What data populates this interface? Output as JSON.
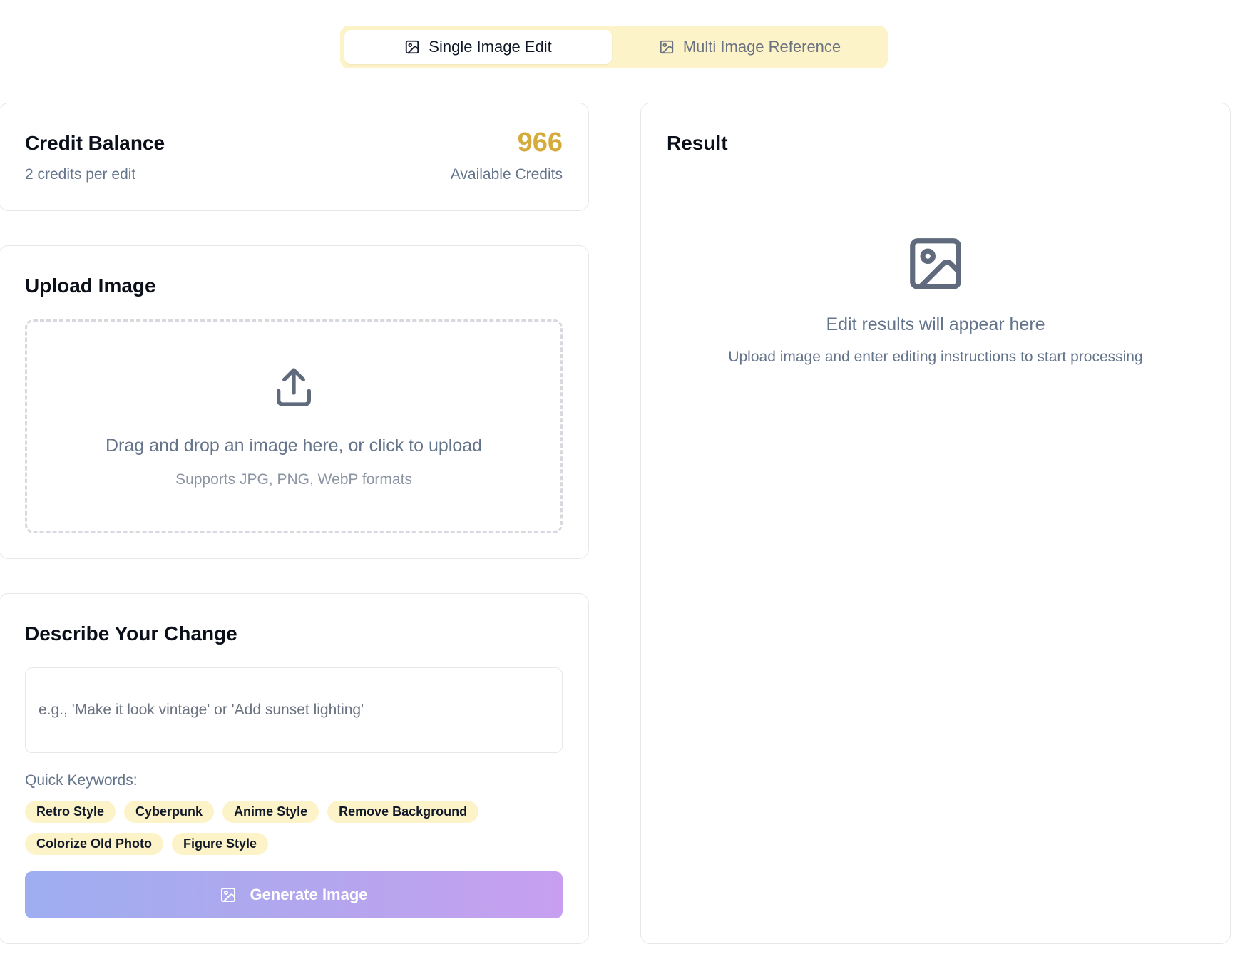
{
  "tabs": {
    "single_label": "Single Image Edit",
    "multi_label": "Multi Image Reference",
    "active": "single"
  },
  "credits": {
    "title": "Credit Balance",
    "per_edit": "2 credits per edit",
    "value": "966",
    "label": "Available Credits",
    "value_color": "#d4ab3c"
  },
  "upload": {
    "title": "Upload Image",
    "drop_text": "Drag and drop an image here, or click to upload",
    "formats": "Supports JPG, PNG, WebP formats"
  },
  "describe": {
    "title": "Describe Your Change",
    "placeholder": "e.g., 'Make it look vintage' or 'Add sunset lighting'",
    "keywords_label": "Quick Keywords:",
    "keywords": [
      "Retro Style",
      "Cyberpunk",
      "Anime Style",
      "Remove Background",
      "Colorize Old Photo",
      "Figure Style"
    ],
    "generate_label": "Generate Image"
  },
  "result": {
    "title": "Result",
    "empty_title": "Edit results will appear here",
    "empty_sub": "Upload image and enter editing instructions to start processing"
  },
  "icons": {
    "tab": "image-icon",
    "upload": "upload-icon",
    "result": "image-placeholder-icon",
    "generate": "image-icon"
  },
  "colors": {
    "accent_bg": "#fdf3c8",
    "gradient_start": "#9eaef0",
    "gradient_end": "#c89ff0"
  }
}
